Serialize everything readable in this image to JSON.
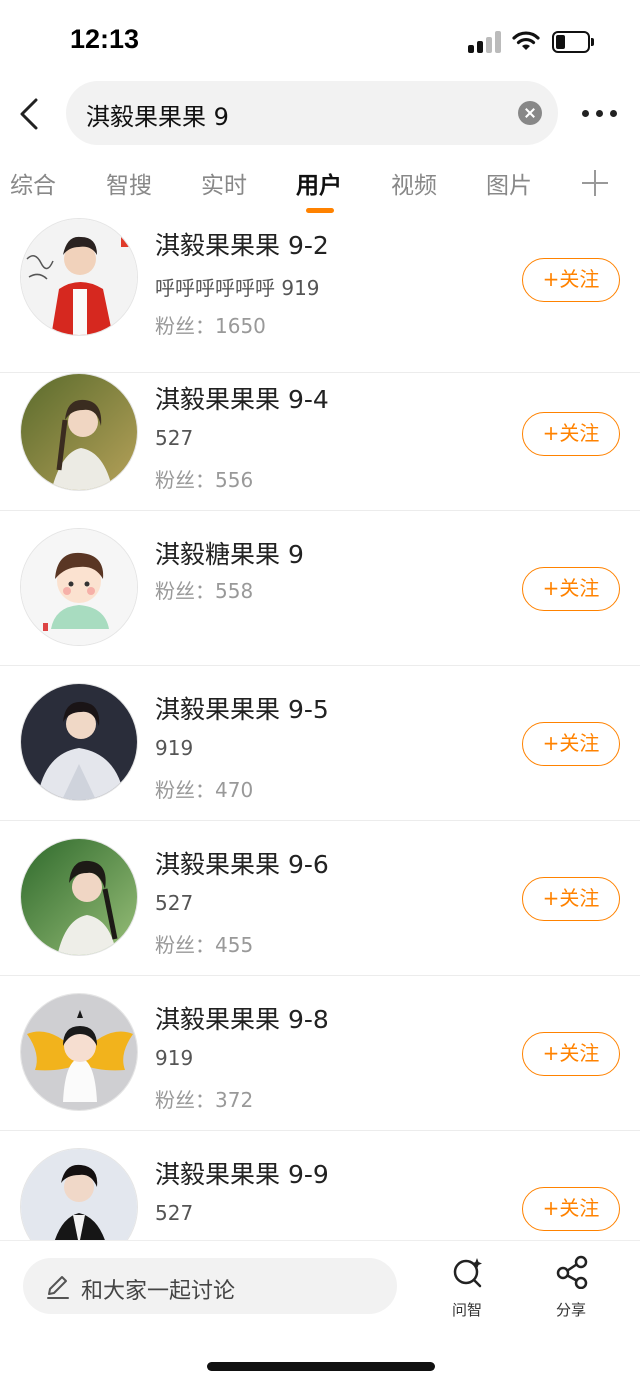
{
  "status_bar": {
    "time": "12:13"
  },
  "search": {
    "query": "淇毅果果果 9"
  },
  "tabs": [
    {
      "label": "综合",
      "active": false
    },
    {
      "label": "智搜",
      "active": false
    },
    {
      "label": "实时",
      "active": false
    },
    {
      "label": "用户",
      "active": true
    },
    {
      "label": "视频",
      "active": false
    },
    {
      "label": "图片",
      "active": false
    }
  ],
  "users": [
    {
      "name": "淇毅果果果 9-2",
      "desc": "呼呼呼呼呼呼 919",
      "fans": "粉丝：1650",
      "follow": "+关注"
    },
    {
      "name": "淇毅果果果 9-4",
      "desc": "527",
      "fans": "粉丝：556",
      "follow": "+关注"
    },
    {
      "name": "淇毅糖果果 9",
      "desc": "",
      "fans": "粉丝：558",
      "follow": "+关注"
    },
    {
      "name": "淇毅果果果 9-5",
      "desc": "919",
      "fans": "粉丝：470",
      "follow": "+关注"
    },
    {
      "name": "淇毅果果果 9-6",
      "desc": "527",
      "fans": "粉丝：455",
      "follow": "+关注"
    },
    {
      "name": "淇毅果果果 9-8",
      "desc": "919",
      "fans": "粉丝：372",
      "follow": "+关注"
    },
    {
      "name": "淇毅果果果 9-9",
      "desc": "527",
      "fans": "",
      "follow": "+关注"
    }
  ],
  "bottom_bar": {
    "discuss_placeholder": "和大家一起讨论",
    "ask_label": "问智",
    "share_label": "分享"
  },
  "colors": {
    "accent": "#ff8200"
  }
}
